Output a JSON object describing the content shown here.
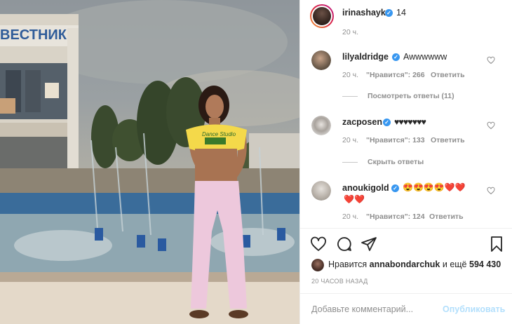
{
  "post": {
    "author": "irinashayk",
    "author_count": "14",
    "time": "20 ч."
  },
  "comments": [
    {
      "username": "lilyaldridge",
      "text": "Awwwwww",
      "time": "20 ч.",
      "likes_label": "\"Нравится\": 266",
      "reply_label": "Ответить",
      "replies_toggle": "Посмотреть ответы (11)"
    },
    {
      "username": "zacposen",
      "text": "♥♥♥♥♥♥♥",
      "time": "20 ч.",
      "likes_label": "\"Нравится\": 133",
      "reply_label": "Ответить",
      "replies_toggle": "Скрыть ответы"
    },
    {
      "username": "anoukigold",
      "text_line1": "😍😍😍😍❤️❤️",
      "text_line2": "❤️❤️",
      "time": "20 ч.",
      "likes_label": "\"Нравится\": 124",
      "reply_label": "Ответить"
    }
  ],
  "photo": {
    "sign_text": "ВЕСТНИК",
    "shirt_text": "Dance Studio"
  },
  "actions": {
    "like_icon": "heart-outline-icon",
    "comment_icon": "comment-bubble-icon",
    "share_icon": "paper-plane-icon",
    "save_icon": "bookmark-icon"
  },
  "likes_summary": {
    "prefix": "Нравится",
    "user": "annabondarchuk",
    "connector": "и ещё",
    "count": "594 430"
  },
  "time_ago": "20 ЧАСОВ НАЗАД",
  "comment_box": {
    "placeholder": "Добавьте комментарий...",
    "publish_label": "Опубликовать"
  },
  "colors": {
    "link_blue": "#3897f0",
    "publish_disabled": "#b2dffc",
    "muted": "#8e8e8e",
    "text": "#262626"
  }
}
